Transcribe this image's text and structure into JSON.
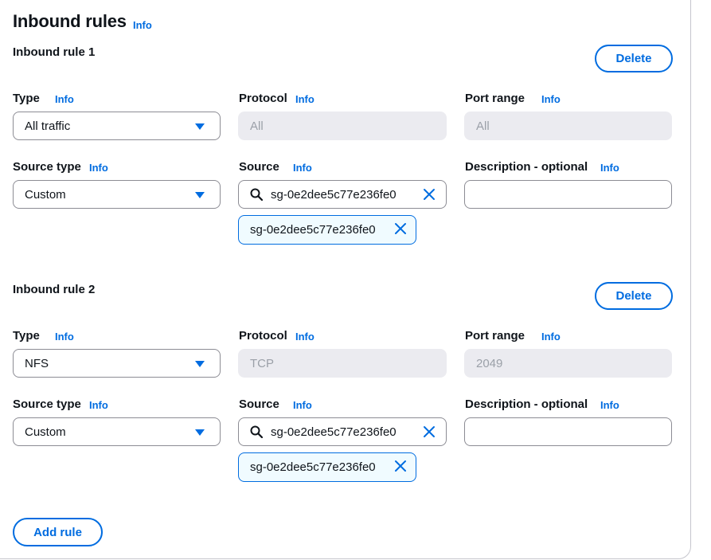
{
  "section": {
    "title": "Inbound rules",
    "info": "Info"
  },
  "labels": {
    "type": "Type",
    "protocol": "Protocol",
    "port_range": "Port range",
    "source_type": "Source type",
    "source": "Source",
    "description": "Description - optional",
    "info": "Info"
  },
  "rules": [
    {
      "title": "Inbound rule 1",
      "delete_label": "Delete",
      "type_value": "All traffic",
      "protocol_value": "All",
      "port_range_value": "All",
      "source_type_value": "Custom",
      "source_search_value": "sg-0e2dee5c77e236fe0",
      "source_token": "sg-0e2dee5c77e236fe0",
      "description_value": ""
    },
    {
      "title": "Inbound rule 2",
      "delete_label": "Delete",
      "type_value": "NFS",
      "protocol_value": "TCP",
      "port_range_value": "2049",
      "source_type_value": "Custom",
      "source_search_value": "sg-0e2dee5c77e236fe0",
      "source_token": "sg-0e2dee5c77e236fe0",
      "description_value": ""
    }
  ],
  "add_rule_label": "Add rule",
  "icons": {
    "dropdown": "caret-down-icon",
    "search": "search-icon",
    "clear": "close-icon",
    "remove_token": "close-icon"
  },
  "colors": {
    "link": "#006ce0",
    "text": "#0f141a",
    "disabled_bg": "#ebebf0",
    "disabled_text": "#9ba0a8",
    "border": "#8c8c94",
    "token_bg": "#f0fbff"
  }
}
